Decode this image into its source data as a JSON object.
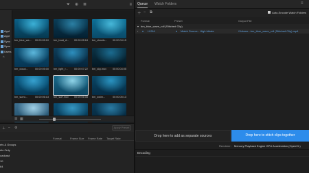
{
  "window": {
    "menu_icon": "≡"
  },
  "media_browser": {
    "toolbar_icons": [
      "filter-icon",
      "new-folder-icon",
      "list-view-icon"
    ],
    "tree": [
      "Appl",
      "Appl",
      "Sync",
      "Sync",
      "Users"
    ],
    "thumbnails": [
      {
        "name": "bm_blue_wa...",
        "duration": "00:00:05:10",
        "colors": [
          "#0b5f86",
          "#3bb0d6",
          "#06384f"
        ]
      },
      {
        "name": "bm_boat_d...",
        "duration": "00:00:05:18",
        "colors": [
          "#0a3d57",
          "#2b7fa3",
          "#041f30"
        ]
      },
      {
        "name": "bm_clouds...",
        "duration": "00:00:04:15",
        "colors": [
          "#0d6f96",
          "#47b7d8",
          "#0a4a68"
        ]
      },
      {
        "name": "bm_cloud...",
        "duration": "00:00:05:00",
        "colors": [
          "#0c4f73",
          "#5cb7dc",
          "#063553"
        ]
      },
      {
        "name": "bm_light_r...",
        "duration": "00:00:07:22",
        "colors": [
          "#0e3e5a",
          "#2d8fbe",
          "#05243a"
        ]
      },
      {
        "name": "bm_sky.mov",
        "duration": "00:00:04:05",
        "colors": [
          "#0b3346",
          "#1b6b8f",
          "#041823"
        ]
      },
      {
        "name": "bm_surro...",
        "duration": "00:00:06:13",
        "colors": [
          "#0a5b84",
          "#36a1cf",
          "#053956"
        ]
      },
      {
        "name": "bm_surf.mov",
        "duration": "00:00:06:08",
        "colors": [
          "#1a6a8a",
          "#8fd3e8",
          "#0b4460"
        ]
      },
      {
        "name": "bm_swim...",
        "duration": "00:00:05:13",
        "colors": [
          "#0a4867",
          "#2a93c0",
          "#052c44"
        ]
      },
      {
        "name": "",
        "duration": "",
        "colors": [
          "#3d6f8f",
          "#9fd0e6",
          "#1f4b66"
        ]
      },
      {
        "name": "",
        "duration": "",
        "colors": [
          "#0b4d70",
          "#3596c1",
          "#06324d"
        ]
      },
      {
        "name": "",
        "duration": "",
        "colors": [
          "#0a3a55",
          "#2a7aa2",
          "#05253a"
        ]
      }
    ],
    "bottom_icons": [
      "list-view-icon",
      "grid-view-icon"
    ]
  },
  "preset_browser": {
    "toolbar_icons": [
      "add-icon",
      "remove-icon",
      "settings-icon"
    ],
    "apply_label": "Apply Preset",
    "columns": [
      "Format",
      "Frame Size",
      "Frame Rate",
      "Target Rate"
    ],
    "first_column": "",
    "rows": [
      "ets & Groups",
      "dio Only",
      "oadcast",
      "10",
      "64"
    ]
  },
  "queue": {
    "tabs": [
      "Queue",
      "Watch Folders"
    ],
    "toolbar_icons": [
      "add-icon",
      "remove-icon",
      "duplicate-icon"
    ],
    "auto_encode_label": "Auto-Encode Watch Folders",
    "columns": [
      "Format",
      "Preset",
      "Output File"
    ],
    "item_title": "bm_blue_wave_roll (Stitched Clip)",
    "sub_item": {
      "format": "H.264",
      "preset": "Match Source - High bitrate",
      "output": "/Volume...bm_blue_wave_roll (Stitched Clip).mp4"
    },
    "drop_left": "Drop here to add as separate sources",
    "drop_right": "Drop here to stitch clips together",
    "renderer_label": "Renderer:",
    "renderer_value": "Mercury Playback Engine GPU Acceleration (OpenCL)",
    "encoding_label": "Encoding"
  }
}
